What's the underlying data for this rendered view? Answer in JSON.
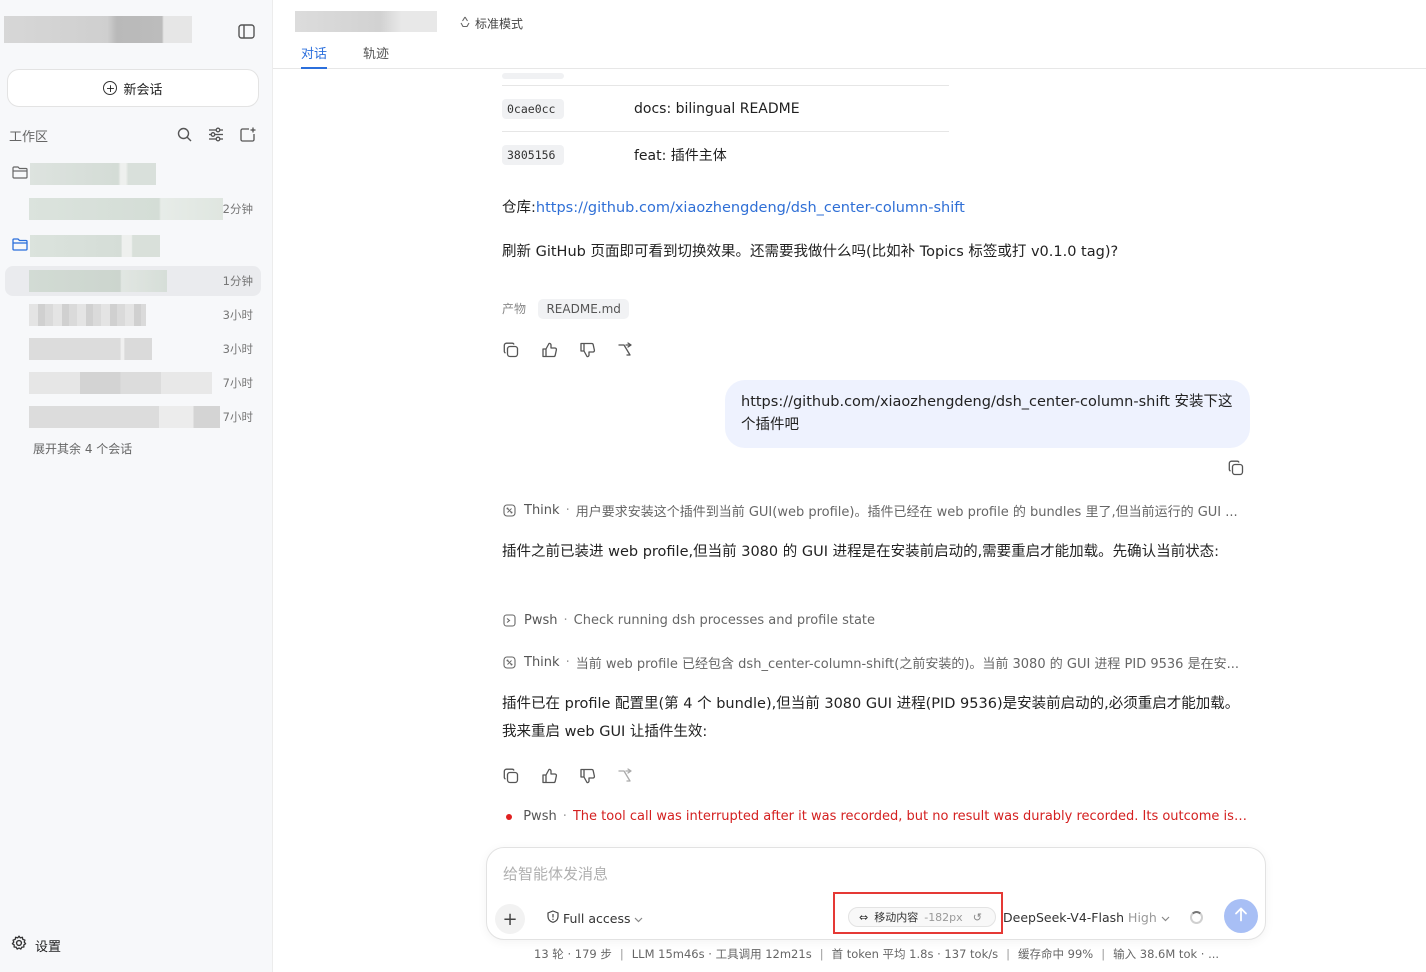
{
  "sidebar": {
    "new_chat_label": "新会话",
    "workspace_label": "工作区",
    "sessions": [
      {
        "time": "2分钟"
      },
      {
        "time": "1分钟"
      },
      {
        "time": "3小时"
      },
      {
        "time": "3小时"
      },
      {
        "time": "7小时"
      },
      {
        "time": "7小时"
      }
    ],
    "expand_more_label": "展开其余 4 个会话",
    "settings_label": "设置"
  },
  "header": {
    "mode_label": "标准模式",
    "tabs": [
      {
        "label": "对话",
        "active": true
      },
      {
        "label": "轨迹",
        "active": false
      }
    ]
  },
  "conversation": {
    "commits": [
      {
        "sha": "0cae0cc",
        "message": "docs: bilingual README"
      },
      {
        "sha": "3805156",
        "message": "feat: 插件主体"
      }
    ],
    "repo_prefix": "仓库:",
    "repo_url": "https://github.com/xiaozhengdeng/dsh_center-column-shift",
    "refresh_text": "刷新 GitHub 页面即可看到切换效果。还需要我做什么吗(比如补 Topics 标签或打 v0.1.0 tag)?",
    "artifact_label": "产物",
    "artifact_file": "README.md",
    "user_message": "https://github.com/xiaozhengdeng/dsh_center-column-shift  安装下这个插件吧",
    "steps": [
      {
        "kind": "Think",
        "detail": "用户要求安装这个插件到当前 GUI(web profile)。插件已经在 web profile 的 bundles 里了,但当前运行的 GUI ..."
      },
      {
        "kind": "Pwsh",
        "detail": "Check running dsh processes and profile state"
      },
      {
        "kind": "Think",
        "detail": "当前 web profile 已经包含 dsh_center-column-shift(之前安装的)。当前 3080 的 GUI 进程 PID 9536 是在安..."
      },
      {
        "kind": "Pwsh",
        "detail": "The tool call was interrupted after it was recorded, but no result was durably recorded. Its outcome is unkno..."
      }
    ],
    "assistant_text_1": "插件之前已装进 web profile,但当前 3080 的 GUI 进程是在安装前启动的,需要重启才能加载。先确认当前状态:",
    "assistant_text_2": "插件已在 profile 配置里(第 4 个 bundle),但当前 3080 GUI 进程(PID 9536)是安装前启动的,必须重启才能加载。我来重启 web GUI 让插件生效:"
  },
  "composer": {
    "placeholder": "给智能体发消息",
    "access_label": "Full access",
    "shift_label": "移动内容",
    "shift_value": "-182px",
    "model_name": "DeepSeek-V4-Flash",
    "model_level": "High"
  },
  "status": {
    "turns": "13 轮 · 179 步",
    "llm": "LLM 15m46s · 工具调用 12m21s",
    "tokens": "首 token 平均 1.8s · 137 tok/s",
    "cache": "缓存命中 99%",
    "input": "输入 38.6M tok · ..."
  },
  "colors": {
    "accent": "#2b6fdc",
    "link": "#2f6fd6",
    "error": "#d42020",
    "user_bubble": "#eef2fe",
    "send_button": "#a8bff5",
    "highlight_box": "#e53935"
  }
}
